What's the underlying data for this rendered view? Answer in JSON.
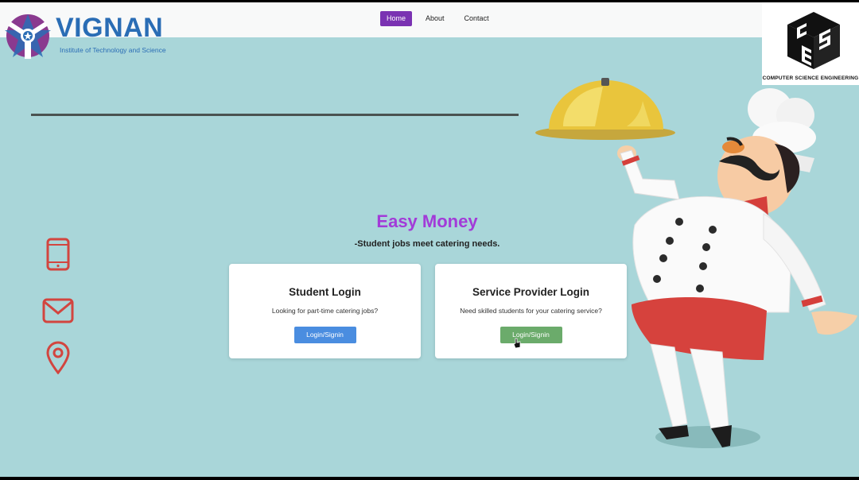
{
  "brand": {
    "name": "VIGNAN",
    "tagline": "Institute of Technology and Science",
    "color": "#2a6db5"
  },
  "nav": {
    "items": [
      {
        "label": "Home",
        "active": true
      },
      {
        "label": "About",
        "active": false
      },
      {
        "label": "Contact",
        "active": false
      }
    ],
    "active_color": "#7a32b2"
  },
  "dept_logo": {
    "caption": "COMPUTER  SCIENCE  ENGINEERING"
  },
  "hero": {
    "title": "Easy Money",
    "subtitle": "-Student jobs meet catering needs."
  },
  "side_icons": [
    "phone-icon",
    "mail-icon",
    "location-pin-icon"
  ],
  "cards": [
    {
      "title": "Student Login",
      "text": "Looking for part-time catering jobs?",
      "button": "Login/Signin",
      "button_color": "#4a8de0"
    },
    {
      "title": "Service Provider Login",
      "text": "Need skilled students for your catering service?",
      "button": "Login/Signin",
      "button_color": "#6bab6b"
    }
  ],
  "colors": {
    "background": "#a9d6d9",
    "accent": "#a23bd8",
    "icon": "#d2453f"
  }
}
